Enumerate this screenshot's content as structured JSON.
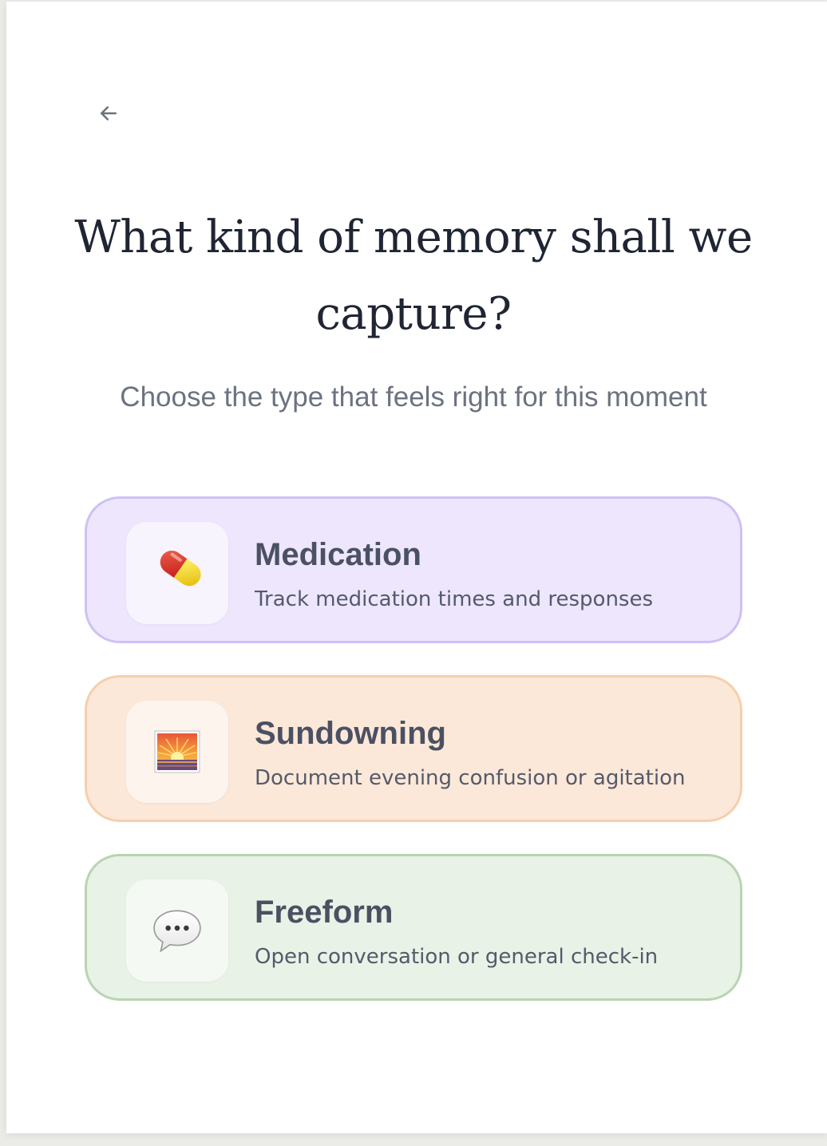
{
  "header": {
    "back_icon": "arrow-left-icon",
    "title": "What kind of memory shall we capture?",
    "subtitle": "Choose the type that feels right for this moment"
  },
  "options": [
    {
      "title": "Medication",
      "description": "Track medication times and responses",
      "icon": "pill-icon",
      "accent_bg": "#ede6fd",
      "accent_border": "#cfc0f4"
    },
    {
      "title": "Sundowning",
      "description": "Document evening confusion or agitation",
      "icon": "sunset-icon",
      "accent_bg": "#fbe8d8",
      "accent_border": "#f5cfae"
    },
    {
      "title": "Freeform",
      "description": "Open conversation or general check-in",
      "icon": "speech-bubble-icon",
      "accent_bg": "#e8f2e6",
      "accent_border": "#b8d4b2"
    }
  ]
}
